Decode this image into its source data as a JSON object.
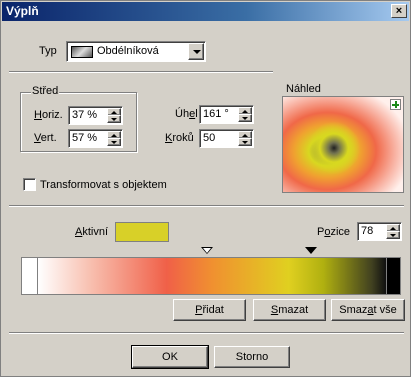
{
  "window": {
    "title": "Výplň"
  },
  "type": {
    "label": "Typ",
    "value": "Obdélníková"
  },
  "center": {
    "legend": "Střed",
    "horiz_label": "Horiz.",
    "horiz_value": "37 %",
    "vert_label": "Vert.",
    "vert_value": "57 %"
  },
  "angle": {
    "label": "Úhel",
    "value": "161 °"
  },
  "steps": {
    "label": "Kroků",
    "value": "50"
  },
  "preview": {
    "label": "Náhled",
    "add_icon": "plus-icon"
  },
  "transform": {
    "label": "Transformovat s objektem",
    "checked": false
  },
  "gradient": {
    "active_label": "Aktivní",
    "active_color": "#d8d028",
    "position_label": "Pozice",
    "position_value": "78",
    "stops": [
      "#ffffff",
      "#f8c0b0",
      "#f06048",
      "#f09030",
      "#e0d020",
      "#b0b010",
      "#404020",
      "#101010"
    ]
  },
  "buttons": {
    "add": "Přidat",
    "delete": "Smazat",
    "delete_all": "Smazat vše",
    "ok": "OK",
    "cancel": "Storno"
  }
}
